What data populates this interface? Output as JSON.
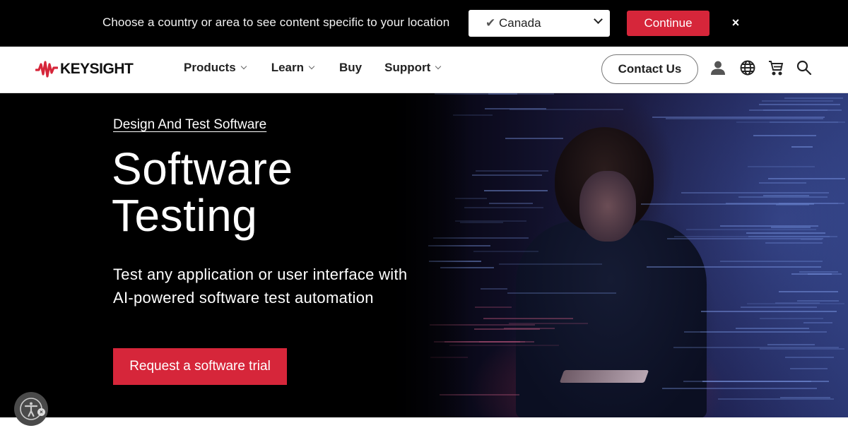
{
  "country_banner": {
    "message": "Choose a country or area to see content specific to your location",
    "selected_country": "Canada",
    "check_glyph": "✔",
    "continue_label": "Continue",
    "close_glyph": "×"
  },
  "header": {
    "brand": "KEYSIGHT",
    "nav": [
      {
        "label": "Products",
        "has_dropdown": true
      },
      {
        "label": "Learn",
        "has_dropdown": true
      },
      {
        "label": "Buy",
        "has_dropdown": false
      },
      {
        "label": "Support",
        "has_dropdown": true
      }
    ],
    "contact_label": "Contact Us",
    "icons": [
      "user-icon",
      "globe-icon",
      "cart-icon",
      "search-icon"
    ]
  },
  "hero": {
    "breadcrumb": "Design And Test Software",
    "title_line1": "Software",
    "title_line2": "Testing",
    "description": "Test any application or user interface with AI-powered software test automation",
    "cta_label": "Request a software trial",
    "image_alt": "Woman using a tablet surrounded by projected code"
  },
  "accessibility": {
    "icon": "accessibility-icon",
    "close_glyph": "×"
  },
  "colors": {
    "brand_red": "#d6263a",
    "banner_bg": "#000000",
    "hero_bg": "#000000",
    "text_dark": "#222222"
  }
}
